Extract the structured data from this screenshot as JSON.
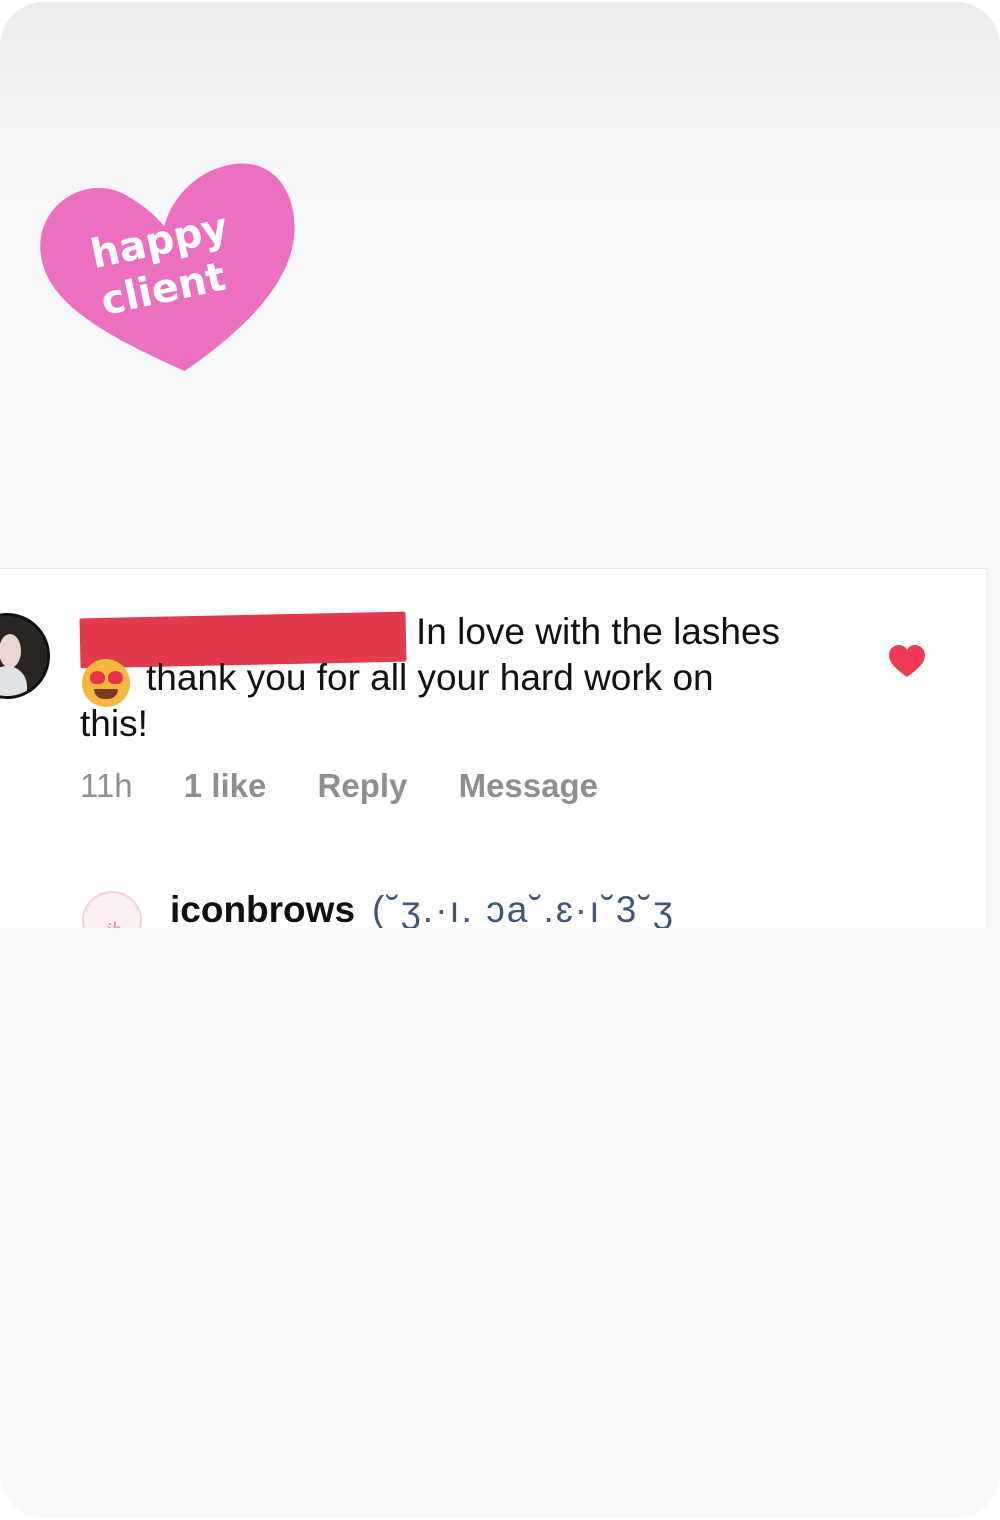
{
  "sticker": {
    "line1": "happy",
    "line2": "client",
    "color": "#ec6fc2"
  },
  "comment": {
    "line1": "In love with the lashes",
    "line2": "thank you for all your hard work on",
    "line3": "this!",
    "redaction_color": "#e23b4e",
    "emoji": "smiling-face-with-heart-eyes",
    "liked": true,
    "like_color": "#ed3a55"
  },
  "meta": {
    "time": "11h",
    "likes": "1 like",
    "reply": "Reply",
    "message": "Message"
  },
  "reply_preview": {
    "username": "iconbrows",
    "mention": "(˘ʒ.·ı. ɔa˘.ɛ·ı˘3˘ʒ"
  }
}
